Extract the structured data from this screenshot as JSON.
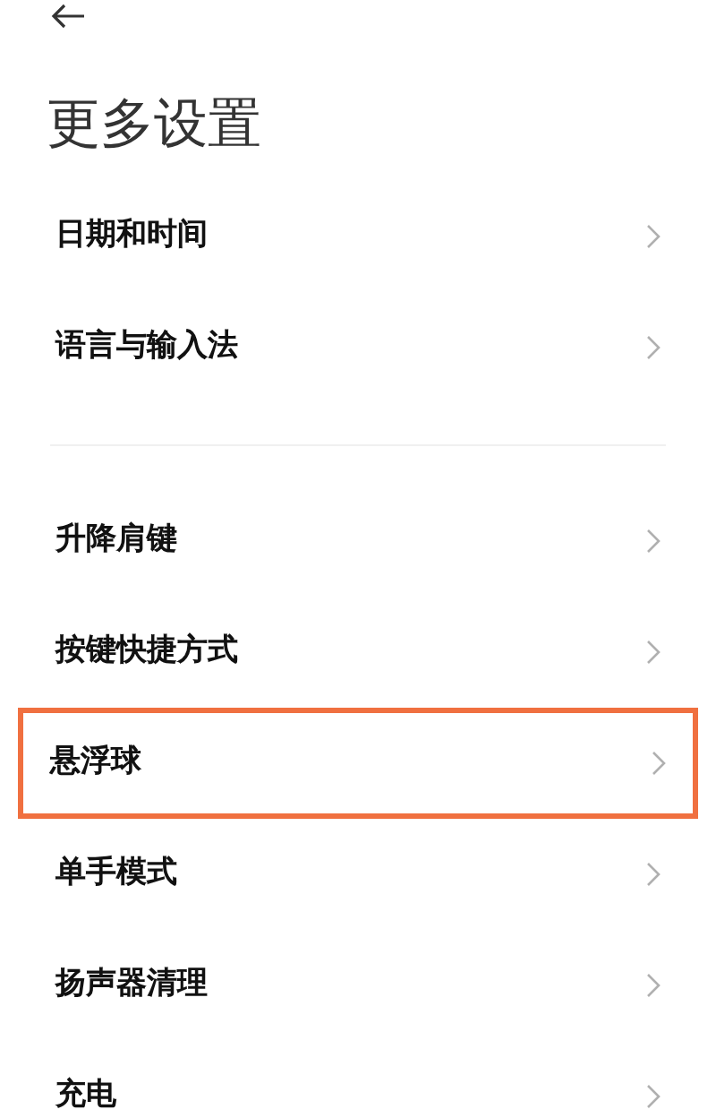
{
  "title": "更多设置",
  "groups": [
    {
      "items": [
        {
          "label": "日期和时间",
          "highlighted": false
        },
        {
          "label": "语言与输入法",
          "highlighted": false
        }
      ]
    },
    {
      "items": [
        {
          "label": "升降肩键",
          "highlighted": false
        },
        {
          "label": "按键快捷方式",
          "highlighted": false
        },
        {
          "label": "悬浮球",
          "highlighted": true
        },
        {
          "label": "单手模式",
          "highlighted": false
        },
        {
          "label": "扬声器清理",
          "highlighted": false
        },
        {
          "label": "充电",
          "highlighted": false
        }
      ]
    }
  ]
}
